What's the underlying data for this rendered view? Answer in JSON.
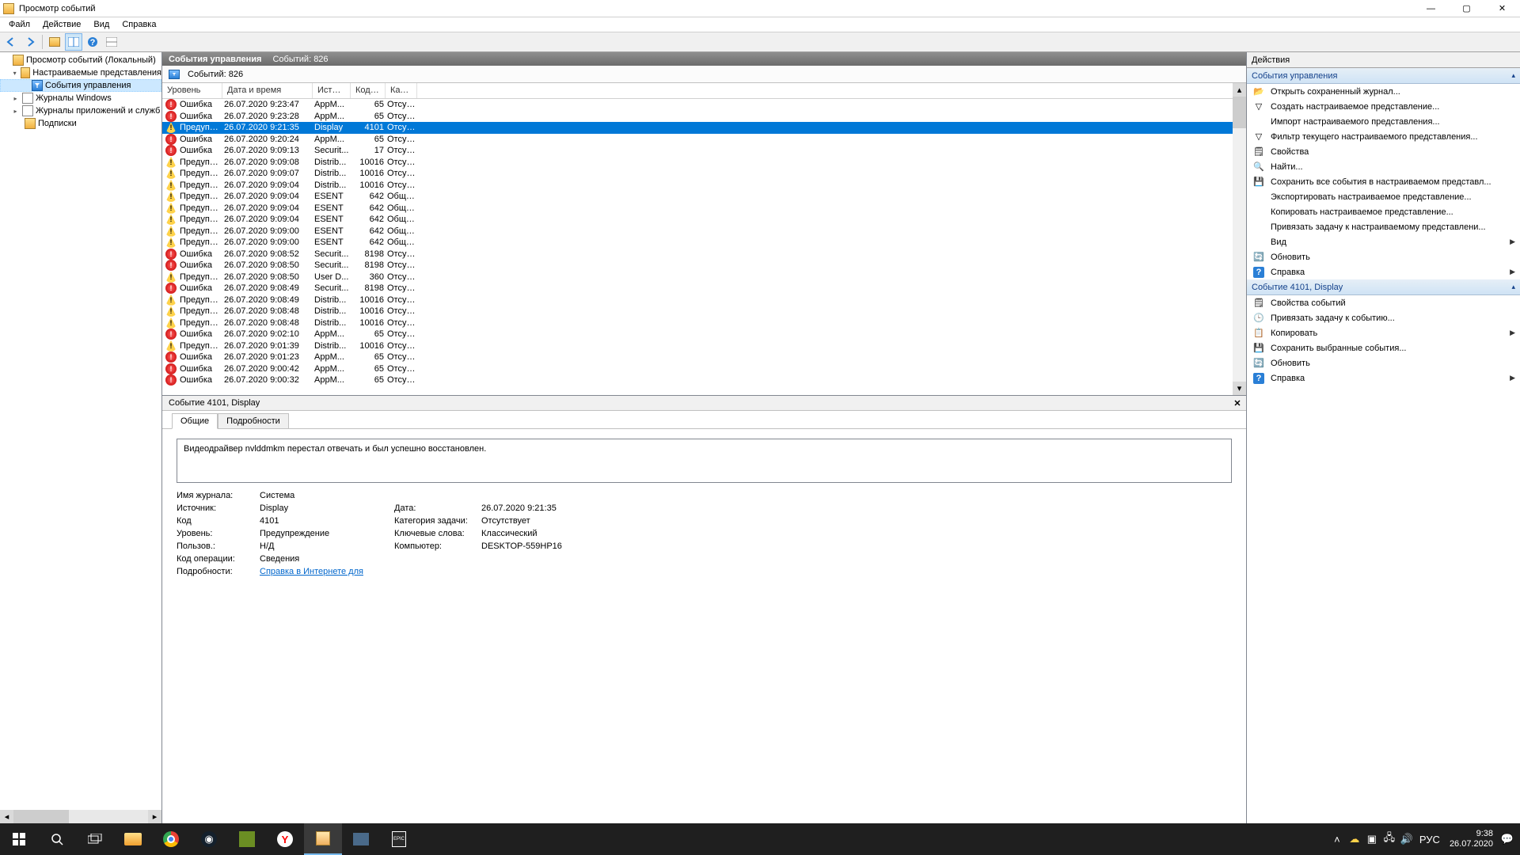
{
  "window": {
    "title": "Просмотр событий"
  },
  "menu": [
    "Файл",
    "Действие",
    "Вид",
    "Справка"
  ],
  "tree": {
    "root": "Просмотр событий (Локальный)",
    "custom_views": "Настраиваемые представления",
    "admin_events": "События управления",
    "win_logs": "Журналы Windows",
    "app_logs": "Журналы приложений и служб",
    "subscriptions": "Подписки"
  },
  "center_title": "События управления",
  "events_count_label": "Событий: 826",
  "filter_label": "Событий: 826",
  "columns": [
    "Уровень",
    "Дата и время",
    "Источ...",
    "Код со...",
    "Катего..."
  ],
  "rows": [
    {
      "level": "Ошибка",
      "type": "error",
      "date": "26.07.2020 9:23:47",
      "src": "AppM...",
      "code": "65",
      "cat": "Отсутс..."
    },
    {
      "level": "Ошибка",
      "type": "error",
      "date": "26.07.2020 9:23:28",
      "src": "AppM...",
      "code": "65",
      "cat": "Отсутс..."
    },
    {
      "level": "Предупреж...",
      "type": "warn",
      "date": "26.07.2020 9:21:35",
      "src": "Display",
      "code": "4101",
      "cat": "Отсутс...",
      "sel": true
    },
    {
      "level": "Ошибка",
      "type": "error",
      "date": "26.07.2020 9:20:24",
      "src": "AppM...",
      "code": "65",
      "cat": "Отсутс..."
    },
    {
      "level": "Ошибка",
      "type": "error",
      "date": "26.07.2020 9:09:13",
      "src": "Securit...",
      "code": "17",
      "cat": "Отсутс..."
    },
    {
      "level": "Предупреж...",
      "type": "warn",
      "date": "26.07.2020 9:09:08",
      "src": "Distrib...",
      "code": "10016",
      "cat": "Отсутс..."
    },
    {
      "level": "Предупреж...",
      "type": "warn",
      "date": "26.07.2020 9:09:07",
      "src": "Distrib...",
      "code": "10016",
      "cat": "Отсутс..."
    },
    {
      "level": "Предупреж...",
      "type": "warn",
      "date": "26.07.2020 9:09:04",
      "src": "Distrib...",
      "code": "10016",
      "cat": "Отсутс..."
    },
    {
      "level": "Предупреж...",
      "type": "warn",
      "date": "26.07.2020 9:09:04",
      "src": "ESENT",
      "code": "642",
      "cat": "Общие"
    },
    {
      "level": "Предупреж...",
      "type": "warn",
      "date": "26.07.2020 9:09:04",
      "src": "ESENT",
      "code": "642",
      "cat": "Общие"
    },
    {
      "level": "Предупреж...",
      "type": "warn",
      "date": "26.07.2020 9:09:04",
      "src": "ESENT",
      "code": "642",
      "cat": "Общие"
    },
    {
      "level": "Предупреж...",
      "type": "warn",
      "date": "26.07.2020 9:09:00",
      "src": "ESENT",
      "code": "642",
      "cat": "Общие"
    },
    {
      "level": "Предупреж...",
      "type": "warn",
      "date": "26.07.2020 9:09:00",
      "src": "ESENT",
      "code": "642",
      "cat": "Общие"
    },
    {
      "level": "Ошибка",
      "type": "error",
      "date": "26.07.2020 9:08:52",
      "src": "Securit...",
      "code": "8198",
      "cat": "Отсутс..."
    },
    {
      "level": "Ошибка",
      "type": "error",
      "date": "26.07.2020 9:08:50",
      "src": "Securit...",
      "code": "8198",
      "cat": "Отсутс..."
    },
    {
      "level": "Предупреж...",
      "type": "warn",
      "date": "26.07.2020 9:08:50",
      "src": "User D...",
      "code": "360",
      "cat": "Отсутс..."
    },
    {
      "level": "Ошибка",
      "type": "error",
      "date": "26.07.2020 9:08:49",
      "src": "Securit...",
      "code": "8198",
      "cat": "Отсутс..."
    },
    {
      "level": "Предупреж...",
      "type": "warn",
      "date": "26.07.2020 9:08:49",
      "src": "Distrib...",
      "code": "10016",
      "cat": "Отсутс..."
    },
    {
      "level": "Предупреж...",
      "type": "warn",
      "date": "26.07.2020 9:08:48",
      "src": "Distrib...",
      "code": "10016",
      "cat": "Отсутс..."
    },
    {
      "level": "Предупреж...",
      "type": "warn",
      "date": "26.07.2020 9:08:48",
      "src": "Distrib...",
      "code": "10016",
      "cat": "Отсутс..."
    },
    {
      "level": "Ошибка",
      "type": "error",
      "date": "26.07.2020 9:02:10",
      "src": "AppM...",
      "code": "65",
      "cat": "Отсутс..."
    },
    {
      "level": "Предупреж...",
      "type": "warn",
      "date": "26.07.2020 9:01:39",
      "src": "Distrib...",
      "code": "10016",
      "cat": "Отсутс..."
    },
    {
      "level": "Ошибка",
      "type": "error",
      "date": "26.07.2020 9:01:23",
      "src": "AppM...",
      "code": "65",
      "cat": "Отсутс..."
    },
    {
      "level": "Ошибка",
      "type": "error",
      "date": "26.07.2020 9:00:42",
      "src": "AppM...",
      "code": "65",
      "cat": "Отсутс..."
    },
    {
      "level": "Ошибка",
      "type": "error",
      "date": "26.07.2020 9:00:32",
      "src": "AppM...",
      "code": "65",
      "cat": "Отсутс..."
    }
  ],
  "detail": {
    "title": "Событие 4101, Display",
    "tabs": {
      "general": "Общие",
      "details": "Подробности"
    },
    "description": "Видеодрайвер nvlddmkm перестал отвечать и был успешно восстановлен.",
    "fields": {
      "log_name_label": "Имя журнала:",
      "log_name": "Система",
      "source_label": "Источник:",
      "source": "Display",
      "date_label": "Дата:",
      "date": "26.07.2020 9:21:35",
      "code_label": "Код",
      "code": "4101",
      "task_label": "Категория задачи:",
      "task": "Отсутствует",
      "level_label": "Уровень:",
      "level": "Предупреждение",
      "keywords_label": "Ключевые слова:",
      "keywords": "Классический",
      "user_label": "Пользов.:",
      "user": "Н/Д",
      "computer_label": "Компьютер:",
      "computer": "DESKTOP-559HP16",
      "opcode_label": "Код операции:",
      "opcode": "Сведения",
      "moreinfo_label": "Подробности:",
      "moreinfo_link": "Справка в Интернете для "
    }
  },
  "actions": {
    "header": "Действия",
    "section1": "События управления",
    "items1": [
      {
        "label": "Открыть сохраненный журнал...",
        "icon": "📂"
      },
      {
        "label": "Создать настраиваемое представление...",
        "icon": "▽"
      },
      {
        "label": "Импорт настраиваемого представления...",
        "icon": ""
      },
      {
        "label": "Фильтр текущего настраиваемого представления...",
        "icon": "▽"
      },
      {
        "label": "Свойства",
        "icon": "🗒"
      },
      {
        "label": "Найти...",
        "icon": "🔍"
      },
      {
        "label": "Сохранить все события в настраиваемом представл...",
        "icon": "💾"
      },
      {
        "label": "Экспортировать настраиваемое представление...",
        "icon": ""
      },
      {
        "label": "Копировать настраиваемое представление...",
        "icon": ""
      },
      {
        "label": "Привязать задачу к настраиваемому представлени...",
        "icon": ""
      },
      {
        "label": "Вид",
        "icon": "",
        "sub": true
      },
      {
        "label": "Обновить",
        "icon": "🔄"
      },
      {
        "label": "Справка",
        "icon": "?",
        "sub": true
      }
    ],
    "section2": "Событие 4101, Display",
    "items2": [
      {
        "label": "Свойства событий",
        "icon": "🗒"
      },
      {
        "label": "Привязать задачу к событию...",
        "icon": "🕒"
      },
      {
        "label": "Копировать",
        "icon": "📋",
        "sub": true
      },
      {
        "label": "Сохранить выбранные события...",
        "icon": "💾"
      },
      {
        "label": "Обновить",
        "icon": "🔄"
      },
      {
        "label": "Справка",
        "icon": "?",
        "sub": true
      }
    ]
  },
  "taskbar": {
    "lang": "РУС",
    "time": "9:38",
    "date": "26.07.2020"
  }
}
